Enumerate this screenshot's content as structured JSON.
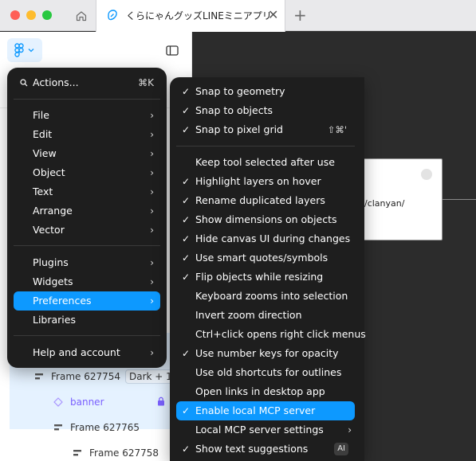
{
  "colors": {
    "accent": "#0d99ff",
    "menu_bg": "#1e1e1e",
    "canvas_bg": "#2c2c2c",
    "traffic_close": "#fe5f57",
    "traffic_minimize": "#febc2e",
    "traffic_maximize": "#28c840",
    "component_purple": "#7b61ff"
  },
  "browser": {
    "tab_title": "くらにゃんグッズLINEミニアプリ",
    "tab_icon": "figma-file-icon",
    "close_glyph": "✕",
    "new_tab_glyph": "+"
  },
  "main_menu": {
    "search_label": "Actions...",
    "search_shortcut": "⌘K",
    "chevron": "›",
    "items": [
      {
        "label": "File"
      },
      {
        "label": "Edit"
      },
      {
        "label": "View"
      },
      {
        "label": "Object"
      },
      {
        "label": "Text"
      },
      {
        "label": "Arrange"
      },
      {
        "label": "Vector"
      },
      {
        "label": "Plugins"
      },
      {
        "label": "Widgets"
      },
      {
        "label": "Preferences"
      },
      {
        "label": "Libraries"
      },
      {
        "label": "Help and account"
      }
    ]
  },
  "preferences_menu": {
    "check": "✓",
    "chevron": "›",
    "items": [
      {
        "label": "Snap to geometry",
        "checked": true
      },
      {
        "label": "Snap to objects",
        "checked": true
      },
      {
        "label": "Snap to pixel grid",
        "checked": true,
        "shortcut": "⇧⌘'"
      },
      {
        "label": "Keep tool selected after use",
        "checked": false
      },
      {
        "label": "Highlight layers on hover",
        "checked": true
      },
      {
        "label": "Rename duplicated layers",
        "checked": true
      },
      {
        "label": "Show dimensions on objects",
        "checked": true
      },
      {
        "label": "Hide canvas UI during changes",
        "checked": true
      },
      {
        "label": "Use smart quotes/symbols",
        "checked": true
      },
      {
        "label": "Flip objects while resizing",
        "checked": true
      },
      {
        "label": "Keyboard zooms into selection",
        "checked": false
      },
      {
        "label": "Invert zoom direction",
        "checked": false
      },
      {
        "label": "Ctrl+click opens right click menus",
        "checked": false
      },
      {
        "label": "Use number keys for opacity",
        "checked": true
      },
      {
        "label": "Use old shortcuts for outlines",
        "checked": false
      },
      {
        "label": "Open links in desktop app",
        "checked": false
      },
      {
        "label": "Enable local MCP server",
        "checked": true
      },
      {
        "label": "Local MCP server settings",
        "checked": false
      },
      {
        "label": "Show text suggestions",
        "checked": true,
        "badge": "AI"
      }
    ]
  },
  "layers": [
    {
      "name": "Frame 627754",
      "badge": "Dark + 1",
      "icon": "auto-layout-icon"
    },
    {
      "name": "banner",
      "icon": "component-instance-icon",
      "locked": true
    },
    {
      "name": "Frame 627765",
      "icon": "auto-layout-icon"
    },
    {
      "name": "Frame 627758",
      "icon": "auto-layout-icon"
    }
  ],
  "canvas": {
    "url_fragment": "w/clanyan/"
  }
}
